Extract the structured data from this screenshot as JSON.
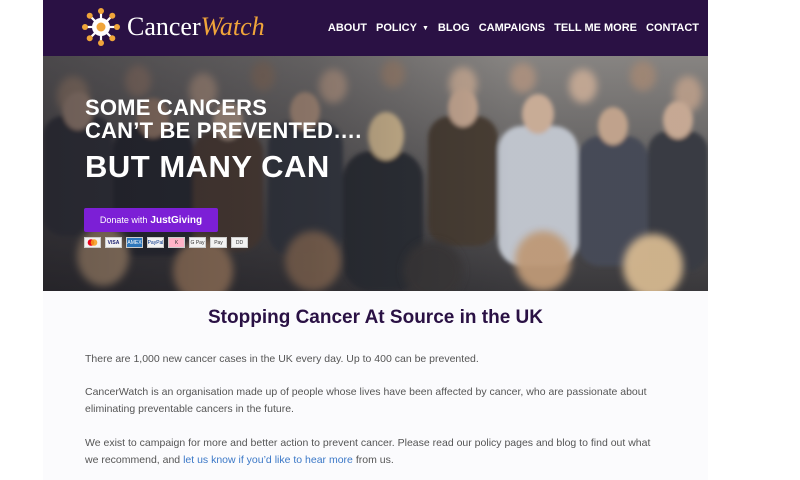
{
  "brand": {
    "name_part1": "Cancer",
    "name_part2": "Watch"
  },
  "nav": [
    {
      "label": "ABOUT"
    },
    {
      "label": "POLICY",
      "has_dropdown": true
    },
    {
      "label": "BLOG"
    },
    {
      "label": "CAMPAIGNS"
    },
    {
      "label": "TELL ME MORE"
    },
    {
      "label": "CONTACT"
    }
  ],
  "hero": {
    "headline_line1": "SOME CANCERS",
    "headline_line2": "CAN’T BE PREVENTED….",
    "headline_big": "BUT MANY CAN",
    "donate_prefix": "Donate with",
    "donate_brand": "JustGiving",
    "payment_methods": [
      "Mastercard",
      "VISA",
      "Amex",
      "PayPal",
      "Klarna",
      "G Pay",
      "Apple Pay",
      "Direct Debit"
    ],
    "payment_labels": [
      "MC",
      "VISA",
      "AMEX",
      "PayPal",
      "K",
      "G Pay",
      "Pay",
      "DD"
    ]
  },
  "main": {
    "title": "Stopping Cancer At Source in the UK",
    "para1": "There are 1,000 new cancer cases in the UK every day. Up to 400 can be prevented.",
    "para2": "CancerWatch is an organisation made up of people whose lives have been affected by cancer, who are passionate about eliminating preventable cancers in the future.",
    "para3_part1": "We exist to campaign for more and better action to prevent cancer. Please read our policy pages and blog to find out what we recommend, and ",
    "para3_link": "let us know if you’d like to hear more",
    "para3_part2": " from us."
  },
  "colors": {
    "header_bg": "#2a1144",
    "accent_orange": "#f0a53a",
    "donate_purple": "#7c1fd6",
    "link_blue": "#3b78c7"
  }
}
